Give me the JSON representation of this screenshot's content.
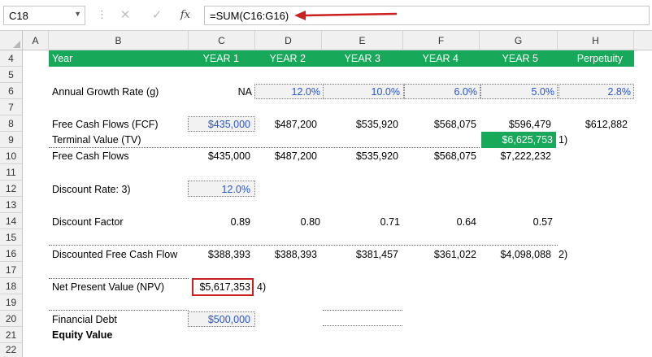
{
  "formula_bar": {
    "name_box": "C18",
    "cancel_icon": "✕",
    "enter_icon": "✓",
    "fx_icon": "fx",
    "formula": "=SUM(C16:G16)",
    "annotation_color": "#cc1f1f"
  },
  "columns": [
    "A",
    "B",
    "C",
    "D",
    "E",
    "F",
    "G",
    "H"
  ],
  "rows": [
    "4",
    "5",
    "6",
    "7",
    "8",
    "9",
    "10",
    "11",
    "12",
    "13",
    "14",
    "15",
    "16",
    "17",
    "18",
    "19",
    "20",
    "21",
    "22"
  ],
  "header_row": {
    "label": "Year",
    "years": [
      "YEAR 1",
      "YEAR 2",
      "YEAR 3",
      "YEAR 4",
      "YEAR 5",
      "Perpetuity"
    ],
    "fill_color": "#17a85a"
  },
  "growth": {
    "label": "Annual Growth Rate (g)",
    "values": [
      "NA",
      "12.0%",
      "10.0%",
      "6.0%",
      "5.0%",
      "2.8%"
    ]
  },
  "fcf": {
    "label": "Free Cash Flows (FCF)",
    "values": [
      "$435,000",
      "$487,200",
      "$535,920",
      "$568,075",
      "$596,479",
      "$612,882"
    ]
  },
  "terminal": {
    "label": "Terminal Value (TV)",
    "value": "$6,625,753",
    "note": "1)"
  },
  "fcf_total": {
    "label": "Free Cash Flows",
    "values": [
      "$435,000",
      "$487,200",
      "$535,920",
      "$568,075",
      "$7,222,232"
    ]
  },
  "discount_rate": {
    "label": "Discount Rate: 3)",
    "value": "12.0%"
  },
  "discount_factor": {
    "label": "Discount Factor",
    "values": [
      "0.89",
      "0.80",
      "0.71",
      "0.64",
      "0.57"
    ]
  },
  "dfcf": {
    "label": "Discounted Free Cash Flow",
    "values": [
      "$388,393",
      "$388,393",
      "$381,457",
      "$361,022",
      "$4,098,088"
    ],
    "note": "2)"
  },
  "npv": {
    "label": "Net Present Value (NPV)",
    "value": "$5,617,353",
    "note": "4)"
  },
  "debt": {
    "label": "Financial Debt",
    "value": "$500,000"
  },
  "equity": {
    "label": "Equity Value"
  }
}
